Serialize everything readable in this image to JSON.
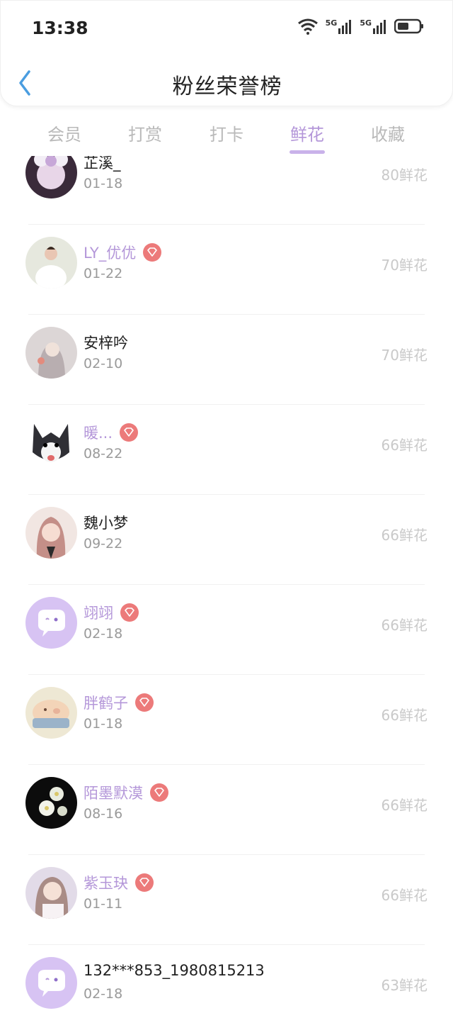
{
  "status_bar": {
    "time": "13:38",
    "signal_label_1": "5G",
    "signal_label_2": "5G"
  },
  "header": {
    "title": "粉丝荣誉榜"
  },
  "tabs": [
    {
      "label": "会员"
    },
    {
      "label": "打赏"
    },
    {
      "label": "打卡"
    },
    {
      "label": "鲜花",
      "active": true
    },
    {
      "label": "收藏"
    }
  ],
  "colors": {
    "accent": "#b497d9",
    "badge": "#ec7a7a",
    "muted": "#c9c9c9"
  },
  "fans": [
    {
      "name": "芷溪_",
      "date": "01-18",
      "flowers": "80鲜花",
      "member": false,
      "avatar_icon": "girl-with-ears-avatar"
    },
    {
      "name": "LY_优优",
      "date": "01-22",
      "flowers": "70鲜花",
      "member": true,
      "avatar_icon": "bride-avatar"
    },
    {
      "name": "安梓吟",
      "date": "02-10",
      "flowers": "70鲜花",
      "member": false,
      "avatar_icon": "girl-flower-avatar"
    },
    {
      "name": "暖...",
      "date": "08-22",
      "flowers": "66鲜花",
      "member": true,
      "avatar_icon": "husky-avatar"
    },
    {
      "name": "魏小梦",
      "date": "09-22",
      "flowers": "66鲜花",
      "member": false,
      "avatar_icon": "anime-girl-avatar"
    },
    {
      "name": "翊翊",
      "date": "02-18",
      "flowers": "66鲜花",
      "member": true,
      "avatar_icon": "default-chat-avatar"
    },
    {
      "name": "胖鹤子",
      "date": "01-18",
      "flowers": "66鲜花",
      "member": true,
      "avatar_icon": "pig-avatar"
    },
    {
      "name": "陌墨默漠",
      "date": "08-16",
      "flowers": "66鲜花",
      "member": true,
      "avatar_icon": "white-flowers-avatar"
    },
    {
      "name": "紫玉玦",
      "date": "01-11",
      "flowers": "66鲜花",
      "member": true,
      "avatar_icon": "girl-portrait-avatar"
    },
    {
      "name": "132***853_1980815213",
      "date": "02-18",
      "flowers": "63鲜花",
      "member": false,
      "avatar_icon": "default-chat-avatar"
    }
  ]
}
